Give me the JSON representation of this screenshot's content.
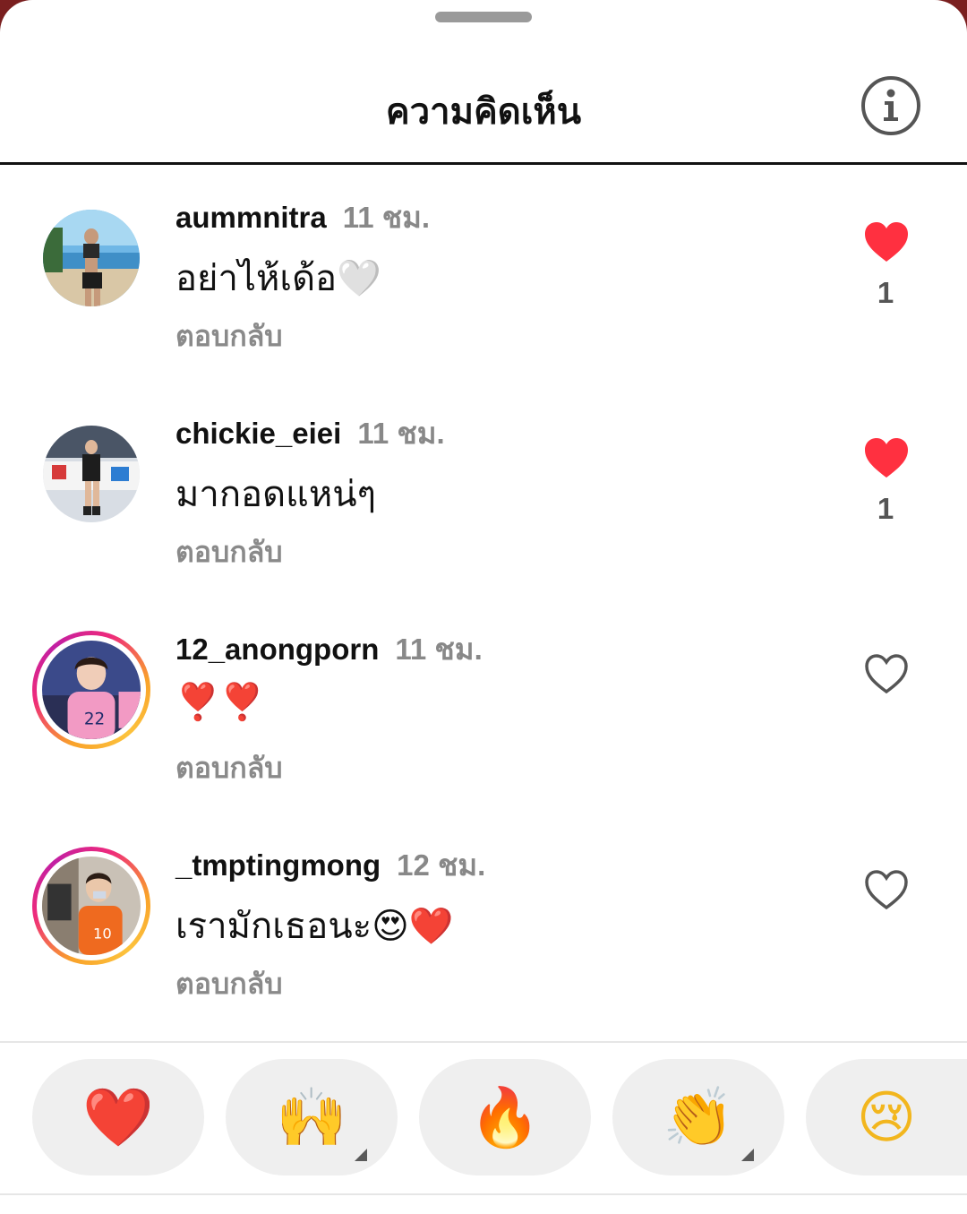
{
  "header": {
    "title": "ความคิดเห็น",
    "info_icon": "info-icon"
  },
  "comments": [
    {
      "username": "aummnitra",
      "time": "11 ชม.",
      "text": "อย่าไห้เด้อ🤍",
      "reply": "ตอบกลับ",
      "liked": true,
      "like_count": "1",
      "story_ring": false
    },
    {
      "username": "chickie_eiei",
      "time": "11 ชม.",
      "text": "มากอดแหน่ๆ",
      "reply": "ตอบกลับ",
      "liked": true,
      "like_count": "1",
      "story_ring": false
    },
    {
      "username": "12_anongporn",
      "time": "11 ชม.",
      "text": "❣️❣️",
      "reply": "ตอบกลับ",
      "liked": false,
      "like_count": "",
      "story_ring": true
    },
    {
      "username": "_tmptingmong",
      "time": "12 ชม.",
      "text": "เรามักเธอนะ😍❤️",
      "reply": "ตอบกลับ",
      "liked": false,
      "like_count": "",
      "story_ring": true
    }
  ],
  "reactions": [
    {
      "emoji": "❤️",
      "icon": "red-heart-icon",
      "has_variants": false
    },
    {
      "emoji": "🙌",
      "icon": "raising-hands-icon",
      "has_variants": true
    },
    {
      "emoji": "🔥",
      "icon": "fire-icon",
      "has_variants": false
    },
    {
      "emoji": "👏",
      "icon": "clapping-hands-icon",
      "has_variants": true
    },
    {
      "emoji": "😢",
      "icon": "crying-face-icon",
      "has_variants": false
    }
  ],
  "colors": {
    "like_red": "#ff3040",
    "muted_text": "#8a8a8a",
    "pill_bg": "#efefef"
  }
}
